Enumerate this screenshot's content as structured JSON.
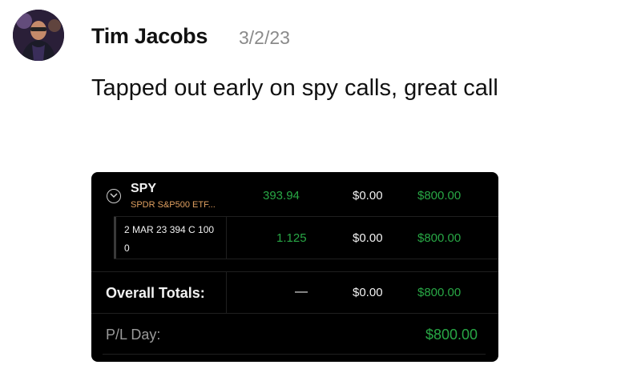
{
  "post": {
    "author": "Tim Jacobs",
    "date": "3/2/23",
    "message": "Tapped out early on spy calls, great call"
  },
  "position_card": {
    "symbol": "SPY",
    "description": "SPDR S&P500 ETF...",
    "price": "393.94",
    "day_change": "$0.00",
    "pl": "$800.00",
    "option": {
      "contract_line1": "2 MAR 23 394 C 100",
      "contract_line2": "0",
      "price": "1.125",
      "day_change": "$0.00",
      "pl": "$800.00"
    },
    "totals": {
      "label": "Overall Totals:",
      "price": "—",
      "day_change": "$0.00",
      "pl": "$800.00"
    },
    "pl_day": {
      "label": "P/L Day:",
      "value": "$800.00"
    }
  },
  "colors": {
    "positive": "#28a745",
    "ticker_desc": "#e0a060",
    "card_bg": "#000000"
  },
  "icons": {
    "avatar": "user-avatar",
    "expand": "chevron-down-icon"
  }
}
